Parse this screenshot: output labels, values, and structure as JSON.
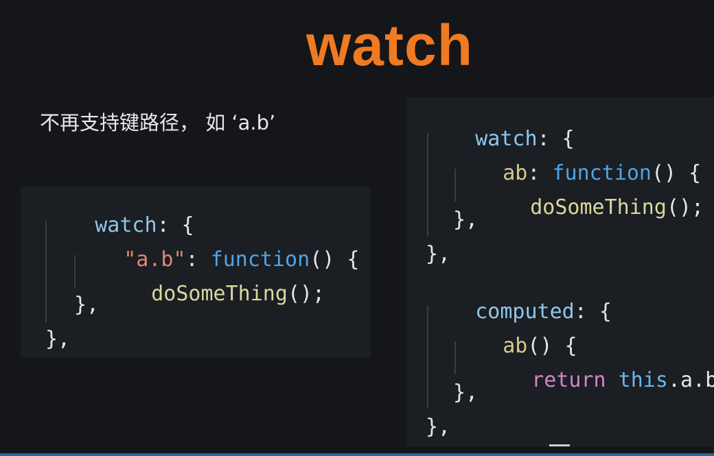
{
  "slide": {
    "title": "watch",
    "subtitle": "不再支持键路径， 如 ‘a.b’"
  },
  "left_code": {
    "l1_key": "watch",
    "l1_rest": ": {",
    "l2_str": "\"a.b\"",
    "l2_colon": ": ",
    "l2_fn": "function",
    "l2_rest": "() {",
    "l3_call": "doSomeThing",
    "l3_rest": "();",
    "l4": "},",
    "l5": "},"
  },
  "right_code": {
    "l1_key": "watch",
    "l1_rest": ": {",
    "l2_key": "ab",
    "l2_colon": ": ",
    "l2_fn": "function",
    "l2_rest": "() {",
    "l3_call": "doSomeThing",
    "l3_rest": "();",
    "l4": "},",
    "l5": "},",
    "l6_key": "computed",
    "l6_rest": ": {",
    "l7_key": "ab",
    "l7_rest": "() {",
    "l8_kw": "return",
    "l8_this": "this",
    "l8_rest": ".a.b;",
    "l9": "},",
    "l10": "},"
  },
  "colors": {
    "title": "#f07a22",
    "background": "#141619",
    "panel": "#1b1e22",
    "property": "#8fc6ea",
    "function_keyword": "#4fa4e8",
    "string": "#e08870",
    "call": "#dbd89f",
    "return_keyword": "#d086c8"
  }
}
